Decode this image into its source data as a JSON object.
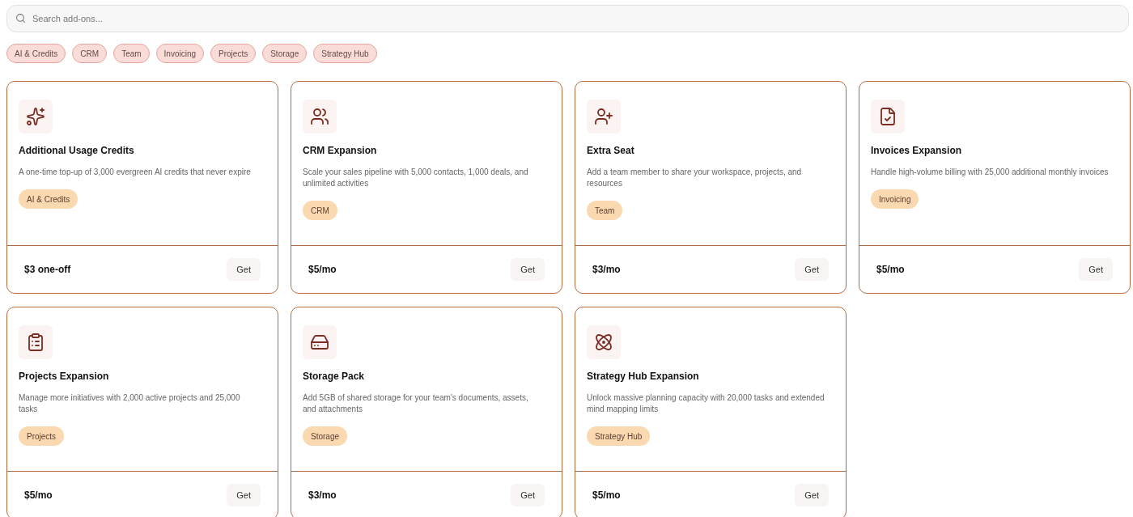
{
  "search": {
    "placeholder": "Search add-ons..."
  },
  "filters": [
    {
      "label": "AI & Credits"
    },
    {
      "label": "CRM"
    },
    {
      "label": "Team"
    },
    {
      "label": "Invoicing"
    },
    {
      "label": "Projects"
    },
    {
      "label": "Storage"
    },
    {
      "label": "Strategy Hub"
    }
  ],
  "addons": [
    {
      "title": "Additional Usage Credits",
      "description": "A one-time top-up of 3,000 evergreen AI credits that never expire",
      "tag": "AI & Credits",
      "price": "$3 one-off",
      "button": "Get"
    },
    {
      "title": "CRM Expansion",
      "description": "Scale your sales pipeline with 5,000 contacts, 1,000 deals, and unlimited activities",
      "tag": "CRM",
      "price": "$5/mo",
      "button": "Get"
    },
    {
      "title": "Extra Seat",
      "description": "Add a team member to share your workspace, projects, and resources",
      "tag": "Team",
      "price": "$3/mo",
      "button": "Get"
    },
    {
      "title": "Invoices Expansion",
      "description": "Handle high-volume billing with 25,000 additional monthly invoices",
      "tag": "Invoicing",
      "price": "$5/mo",
      "button": "Get"
    },
    {
      "title": "Projects Expansion",
      "description": "Manage more initiatives with 2,000 active projects and 25,000 tasks",
      "tag": "Projects",
      "price": "$5/mo",
      "button": "Get"
    },
    {
      "title": "Storage Pack",
      "description": "Add 5GB of shared storage for your team's documents, assets, and attachments",
      "tag": "Storage",
      "price": "$3/mo",
      "button": "Get"
    },
    {
      "title": "Strategy Hub Expansion",
      "description": "Unlock massive planning capacity with 20,000 tasks and extended mind mapping limits",
      "tag": "Strategy Hub",
      "price": "$5/mo",
      "button": "Get"
    }
  ]
}
